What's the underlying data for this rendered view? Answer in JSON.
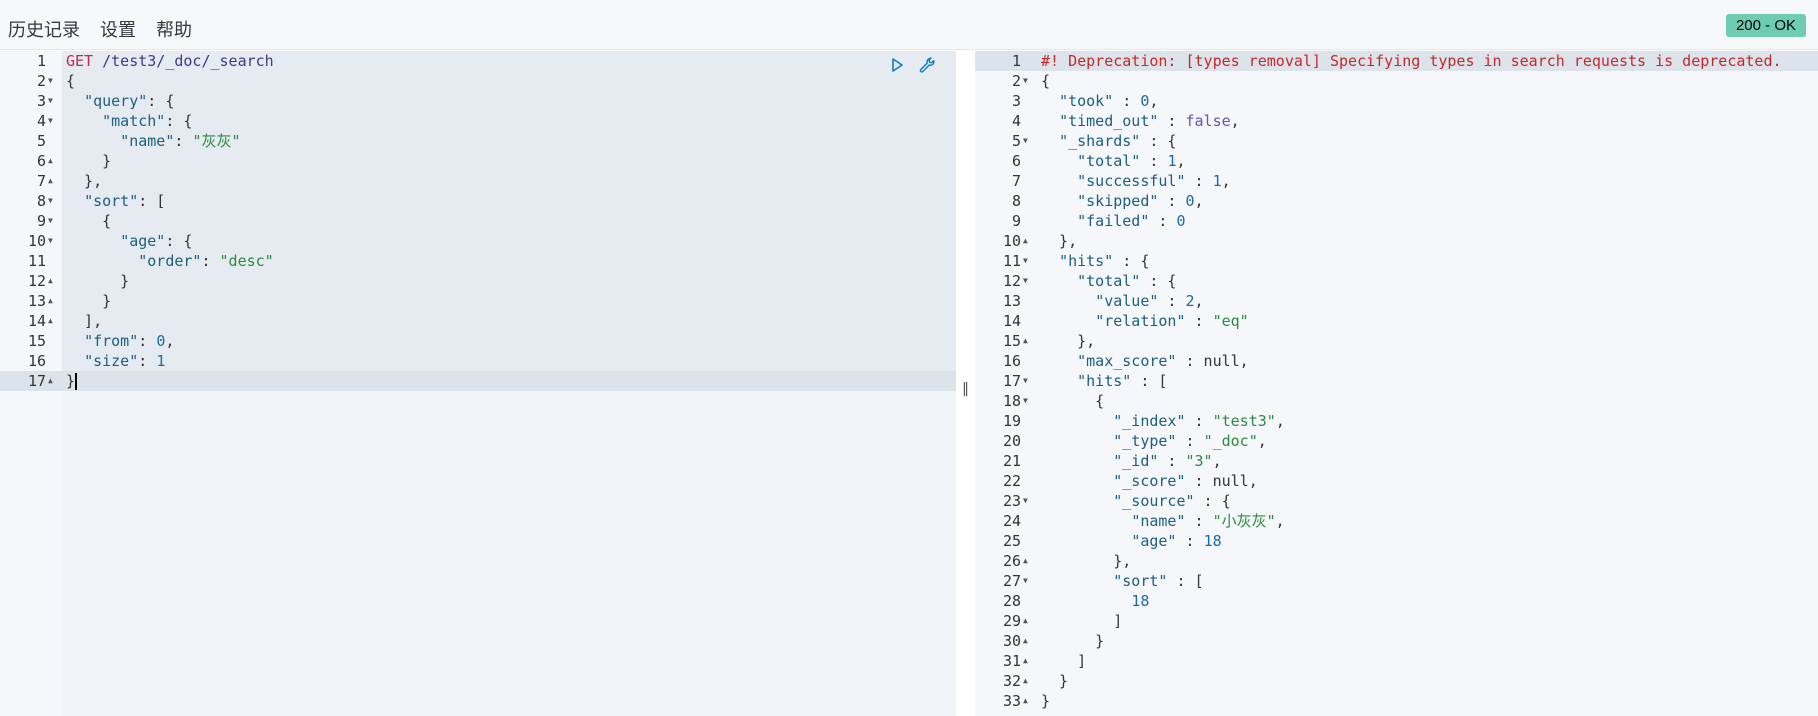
{
  "menu": {
    "history": "历史记录",
    "settings": "设置",
    "help": "帮助"
  },
  "status": {
    "label": "200 - OK",
    "color": "#6dccb1"
  },
  "request": {
    "lines": [
      [
        [
          "k",
          "GET"
        ],
        [
          "p",
          " "
        ],
        [
          "u",
          "/test3/_doc/_search"
        ]
      ],
      [
        [
          "p",
          "{"
        ]
      ],
      [
        [
          "p",
          "  "
        ],
        [
          "key",
          "\"query\""
        ],
        [
          "p",
          ": {"
        ]
      ],
      [
        [
          "p",
          "    "
        ],
        [
          "key",
          "\"match\""
        ],
        [
          "p",
          ": {"
        ]
      ],
      [
        [
          "p",
          "      "
        ],
        [
          "key",
          "\"name\""
        ],
        [
          "p",
          ": "
        ],
        [
          "s",
          "\"灰灰\""
        ]
      ],
      [
        [
          "p",
          "    }"
        ]
      ],
      [
        [
          "p",
          "  },"
        ]
      ],
      [
        [
          "p",
          "  "
        ],
        [
          "key",
          "\"sort\""
        ],
        [
          "p",
          ": ["
        ]
      ],
      [
        [
          "p",
          "    {"
        ]
      ],
      [
        [
          "p",
          "      "
        ],
        [
          "key",
          "\"age\""
        ],
        [
          "p",
          ": {"
        ]
      ],
      [
        [
          "p",
          "        "
        ],
        [
          "key",
          "\"order\""
        ],
        [
          "p",
          ": "
        ],
        [
          "s",
          "\"desc\""
        ]
      ],
      [
        [
          "p",
          "      }"
        ]
      ],
      [
        [
          "p",
          "    }"
        ]
      ],
      [
        [
          "p",
          "  ],"
        ]
      ],
      [
        [
          "p",
          "  "
        ],
        [
          "key",
          "\"from\""
        ],
        [
          "p",
          ": "
        ],
        [
          "n",
          "0"
        ],
        [
          "p",
          ","
        ]
      ],
      [
        [
          "p",
          "  "
        ],
        [
          "key",
          "\"size\""
        ],
        [
          "p",
          ": "
        ],
        [
          "n",
          "1"
        ]
      ],
      [
        [
          "p",
          "}"
        ]
      ]
    ],
    "folds": [
      "",
      "down",
      "down",
      "down",
      "",
      "up",
      "up",
      "down",
      "down",
      "down",
      "",
      "up",
      "up",
      "up",
      "",
      "",
      "up"
    ]
  },
  "response": {
    "lines": [
      [
        [
          "dep",
          "#! Deprecation: [types removal] Specifying types in search requests is deprecated."
        ]
      ],
      [
        [
          "p",
          "{"
        ]
      ],
      [
        [
          "p",
          "  "
        ],
        [
          "key",
          "\"took\""
        ],
        [
          "p",
          " : "
        ],
        [
          "n",
          "0"
        ],
        [
          "p",
          ","
        ]
      ],
      [
        [
          "p",
          "  "
        ],
        [
          "key",
          "\"timed_out\""
        ],
        [
          "p",
          " : "
        ],
        [
          "b",
          "false"
        ],
        [
          "p",
          ","
        ]
      ],
      [
        [
          "p",
          "  "
        ],
        [
          "key",
          "\"_shards\""
        ],
        [
          "p",
          " : {"
        ]
      ],
      [
        [
          "p",
          "    "
        ],
        [
          "key",
          "\"total\""
        ],
        [
          "p",
          " : "
        ],
        [
          "n",
          "1"
        ],
        [
          "p",
          ","
        ]
      ],
      [
        [
          "p",
          "    "
        ],
        [
          "key",
          "\"successful\""
        ],
        [
          "p",
          " : "
        ],
        [
          "n",
          "1"
        ],
        [
          "p",
          ","
        ]
      ],
      [
        [
          "p",
          "    "
        ],
        [
          "key",
          "\"skipped\""
        ],
        [
          "p",
          " : "
        ],
        [
          "n",
          "0"
        ],
        [
          "p",
          ","
        ]
      ],
      [
        [
          "p",
          "    "
        ],
        [
          "key",
          "\"failed\""
        ],
        [
          "p",
          " : "
        ],
        [
          "n",
          "0"
        ]
      ],
      [
        [
          "p",
          "  },"
        ]
      ],
      [
        [
          "p",
          "  "
        ],
        [
          "key",
          "\"hits\""
        ],
        [
          "p",
          " : {"
        ]
      ],
      [
        [
          "p",
          "    "
        ],
        [
          "key",
          "\"total\""
        ],
        [
          "p",
          " : {"
        ]
      ],
      [
        [
          "p",
          "      "
        ],
        [
          "key",
          "\"value\""
        ],
        [
          "p",
          " : "
        ],
        [
          "n",
          "2"
        ],
        [
          "p",
          ","
        ]
      ],
      [
        [
          "p",
          "      "
        ],
        [
          "key",
          "\"relation\""
        ],
        [
          "p",
          " : "
        ],
        [
          "s",
          "\"eq\""
        ]
      ],
      [
        [
          "p",
          "    },"
        ]
      ],
      [
        [
          "p",
          "    "
        ],
        [
          "key",
          "\"max_score\""
        ],
        [
          "p",
          " : null,"
        ]
      ],
      [
        [
          "p",
          "    "
        ],
        [
          "key",
          "\"hits\""
        ],
        [
          "p",
          " : ["
        ]
      ],
      [
        [
          "p",
          "      {"
        ]
      ],
      [
        [
          "p",
          "        "
        ],
        [
          "key",
          "\"_index\""
        ],
        [
          "p",
          " : "
        ],
        [
          "s",
          "\"test3\""
        ],
        [
          "p",
          ","
        ]
      ],
      [
        [
          "p",
          "        "
        ],
        [
          "key",
          "\"_type\""
        ],
        [
          "p",
          " : "
        ],
        [
          "s",
          "\"_doc\""
        ],
        [
          "p",
          ","
        ]
      ],
      [
        [
          "p",
          "        "
        ],
        [
          "key",
          "\"_id\""
        ],
        [
          "p",
          " : "
        ],
        [
          "s",
          "\"3\""
        ],
        [
          "p",
          ","
        ]
      ],
      [
        [
          "p",
          "        "
        ],
        [
          "key",
          "\"_score\""
        ],
        [
          "p",
          " : null,"
        ]
      ],
      [
        [
          "p",
          "        "
        ],
        [
          "key",
          "\"_source\""
        ],
        [
          "p",
          " : {"
        ]
      ],
      [
        [
          "p",
          "          "
        ],
        [
          "key",
          "\"name\""
        ],
        [
          "p",
          " : "
        ],
        [
          "s",
          "\"小灰灰\""
        ],
        [
          "p",
          ","
        ]
      ],
      [
        [
          "p",
          "          "
        ],
        [
          "key",
          "\"age\""
        ],
        [
          "p",
          " : "
        ],
        [
          "n",
          "18"
        ]
      ],
      [
        [
          "p",
          "        },"
        ]
      ],
      [
        [
          "p",
          "        "
        ],
        [
          "key",
          "\"sort\""
        ],
        [
          "p",
          " : ["
        ]
      ],
      [
        [
          "p",
          "          "
        ],
        [
          "n",
          "18"
        ]
      ],
      [
        [
          "p",
          "        ]"
        ]
      ],
      [
        [
          "p",
          "      }"
        ]
      ],
      [
        [
          "p",
          "    ]"
        ]
      ],
      [
        [
          "p",
          "  }"
        ]
      ],
      [
        [
          "p",
          "}"
        ]
      ]
    ],
    "folds": [
      "",
      "down",
      "",
      "",
      "down",
      "",
      "",
      "",
      "",
      "up",
      "down",
      "down",
      "",
      "",
      "up",
      "",
      "down",
      "down",
      "",
      "",
      "",
      "",
      "down",
      "",
      "",
      "up",
      "down",
      "",
      "up",
      "up",
      "up",
      "up",
      "up"
    ]
  },
  "icons": {
    "run": "play-icon",
    "wrench": "wrench-icon",
    "splitter": "drag-handle-icon"
  },
  "splitter_glyph": "‖"
}
